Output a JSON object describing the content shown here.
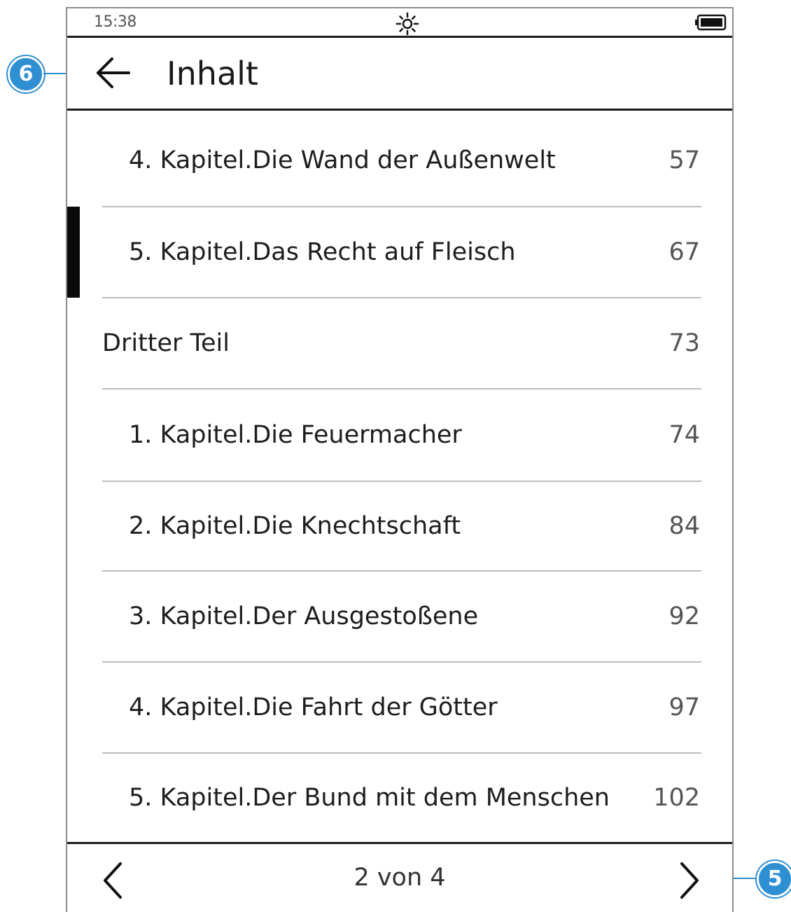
{
  "status": {
    "time": "15:38"
  },
  "header": {
    "title": "Inhalt"
  },
  "toc": [
    {
      "label": "4. Kapitel.Die Wand der Außenwelt",
      "page": "57",
      "level": 2
    },
    {
      "label": "5. Kapitel.Das Recht auf Fleisch",
      "page": "67",
      "level": 2,
      "current": true
    },
    {
      "label": "Dritter Teil",
      "page": "73",
      "level": 1
    },
    {
      "label": "1. Kapitel.Die Feuermacher",
      "page": "74",
      "level": 2
    },
    {
      "label": "2. Kapitel.Die Knechtschaft",
      "page": "84",
      "level": 2
    },
    {
      "label": "3. Kapitel.Der Ausgestoßene",
      "page": "92",
      "level": 2
    },
    {
      "label": "4. Kapitel.Die Fahrt der Götter",
      "page": "97",
      "level": 2
    },
    {
      "label": "5. Kapitel.Der Bund mit dem Menschen",
      "page": "102",
      "level": 2
    }
  ],
  "footer": {
    "page_indicator": "2 von 4"
  },
  "callouts": {
    "back": "6",
    "next": "5"
  },
  "icons": {
    "back": "arrow-left-icon",
    "light": "frontlight-icon",
    "battery": "battery-icon",
    "prev": "chevron-left-icon",
    "next": "chevron-right-icon"
  },
  "colors": {
    "callout": "#2e8fd3",
    "ink": "#1b1b1b",
    "divider": "#bdbdbd"
  }
}
